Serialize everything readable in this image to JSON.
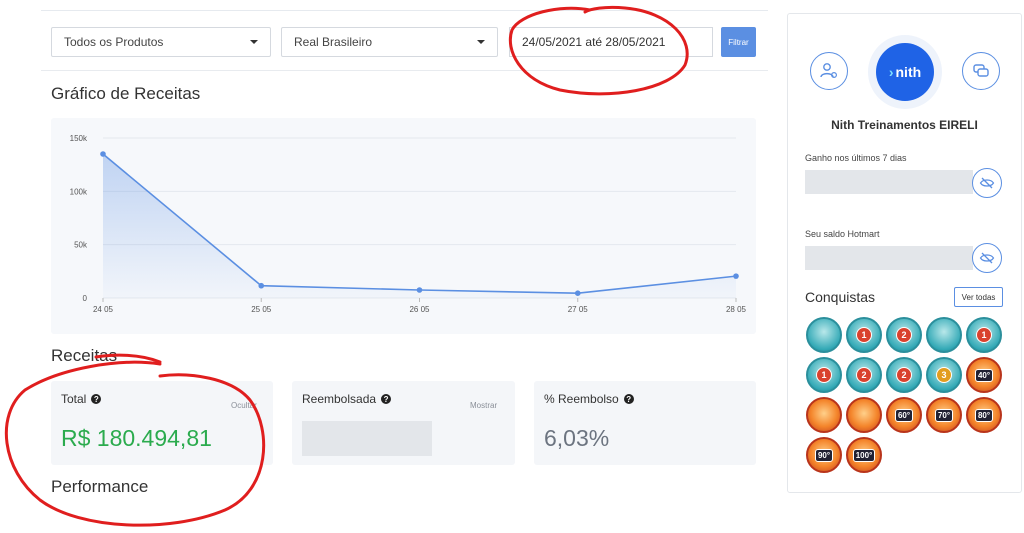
{
  "filters": {
    "product_select": "Todos os Produtos",
    "currency_select": "Real Brasileiro",
    "date_range": "24/05/2021 até 28/05/2021",
    "filter_button": "Filtrar"
  },
  "revenue_chart": {
    "title": "Gráfico de Receitas",
    "chart_data": {
      "type": "area",
      "categories": [
        "24 05",
        "25 05",
        "26 05",
        "27 05",
        "28 05"
      ],
      "values": [
        135000,
        11500,
        7500,
        4500,
        20500
      ],
      "y_ticks": [
        "0",
        "50k",
        "100k",
        "150k"
      ],
      "ylim": [
        0,
        150000
      ],
      "color": "#5b8fe2",
      "grid": true
    }
  },
  "receitas": {
    "title": "Receitas",
    "total": {
      "label": "Total",
      "toggle": "Ocultar",
      "value": "R$ 180.494,81",
      "value_color": "#2bab4e"
    },
    "reembolsada": {
      "label": "Reembolsada",
      "toggle": "Mostrar"
    },
    "percent_reembolso": {
      "label": "% Reembolso",
      "value": "6,03%"
    }
  },
  "performance": {
    "title": "Performance"
  },
  "profile": {
    "logo_text": "nith",
    "company_name": "Nith Treinamentos EIRELI",
    "earnings_label": "Ganho nos últimos 7 dias",
    "balance_label": "Seu saldo Hotmart"
  },
  "achievements": {
    "title": "Conquistas",
    "view_all": "Ver todas",
    "badges": [
      {
        "icon": "badge-start-icon",
        "label": ""
      },
      {
        "icon": "badge-rank-1-icon",
        "label": "1"
      },
      {
        "icon": "badge-rank-2-icon",
        "label": "2"
      },
      {
        "icon": "badge-trophy-icon",
        "label": ""
      },
      {
        "icon": "badge-android-1-icon",
        "label": "1"
      },
      {
        "icon": "badge-android-1b-icon",
        "label": "1"
      },
      {
        "icon": "badge-android-2-icon",
        "label": "2"
      },
      {
        "icon": "badge-android-2b-icon",
        "label": "2"
      },
      {
        "icon": "badge-android-3-icon",
        "label": "3"
      },
      {
        "icon": "badge-fire-40-icon",
        "label": "40°"
      },
      {
        "icon": "badge-ninja-icon",
        "label": ""
      },
      {
        "icon": "badge-fire-icon",
        "label": ""
      },
      {
        "icon": "badge-60-icon",
        "label": "60°"
      },
      {
        "icon": "badge-70-icon",
        "label": "70°"
      },
      {
        "icon": "badge-80-icon",
        "label": "80°"
      },
      {
        "icon": "badge-90-icon",
        "label": "90°"
      },
      {
        "icon": "badge-100-icon",
        "label": "100°"
      }
    ]
  }
}
